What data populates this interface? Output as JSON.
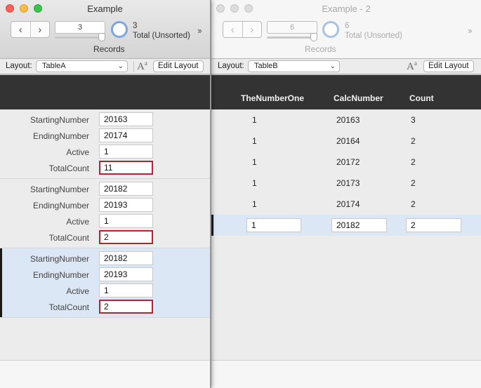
{
  "left_window": {
    "title": "Example",
    "record_field": "3",
    "found_count": "3",
    "found_status": "Total (Unsorted)",
    "records_label": "Records",
    "layout_label": "Layout:",
    "layout_value": "TableA",
    "edit_layout_label": "Edit Layout",
    "records": [
      {
        "starting_label": "StartingNumber",
        "starting_value": "20163",
        "ending_label": "EndingNumber",
        "ending_value": "20174",
        "active_label": "Active",
        "active_value": "1",
        "total_label": "TotalCount",
        "total_value": "11"
      },
      {
        "starting_label": "StartingNumber",
        "starting_value": "20182",
        "ending_label": "EndingNumber",
        "ending_value": "20193",
        "active_label": "Active",
        "active_value": "1",
        "total_label": "TotalCount",
        "total_value": "2"
      },
      {
        "starting_label": "StartingNumber",
        "starting_value": "20182",
        "ending_label": "EndingNumber",
        "ending_value": "20193",
        "active_label": "Active",
        "active_value": "1",
        "total_label": "TotalCount",
        "total_value": "2"
      }
    ]
  },
  "right_window": {
    "title": "Example - 2",
    "record_field": "6",
    "found_count": "6",
    "found_status": "Total (Unsorted)",
    "records_label": "Records",
    "layout_label": "Layout:",
    "layout_value": "TableB",
    "edit_layout_label": "Edit Layout",
    "columns": [
      "TheNumberOne",
      "CalcNumber",
      "Count"
    ],
    "rows": [
      [
        "1",
        "20163",
        "3"
      ],
      [
        "1",
        "20164",
        "2"
      ],
      [
        "1",
        "20172",
        "2"
      ],
      [
        "1",
        "20173",
        "2"
      ],
      [
        "1",
        "20174",
        "2"
      ],
      [
        "1",
        "20182",
        "2"
      ]
    ]
  },
  "colors": {
    "header_band": "#333333",
    "active_record": "#dce7f6",
    "calc_border": "#b52530",
    "close": "#fc605c",
    "minimize": "#fdbc40",
    "maximize": "#34c84a"
  },
  "icons": {
    "nav_prev": "chevron-left-icon",
    "nav_next": "chevron-right-icon",
    "overflow": "double-chevron-right-icon",
    "font_size": "text-size-icon",
    "pie": "records-pie-icon"
  }
}
